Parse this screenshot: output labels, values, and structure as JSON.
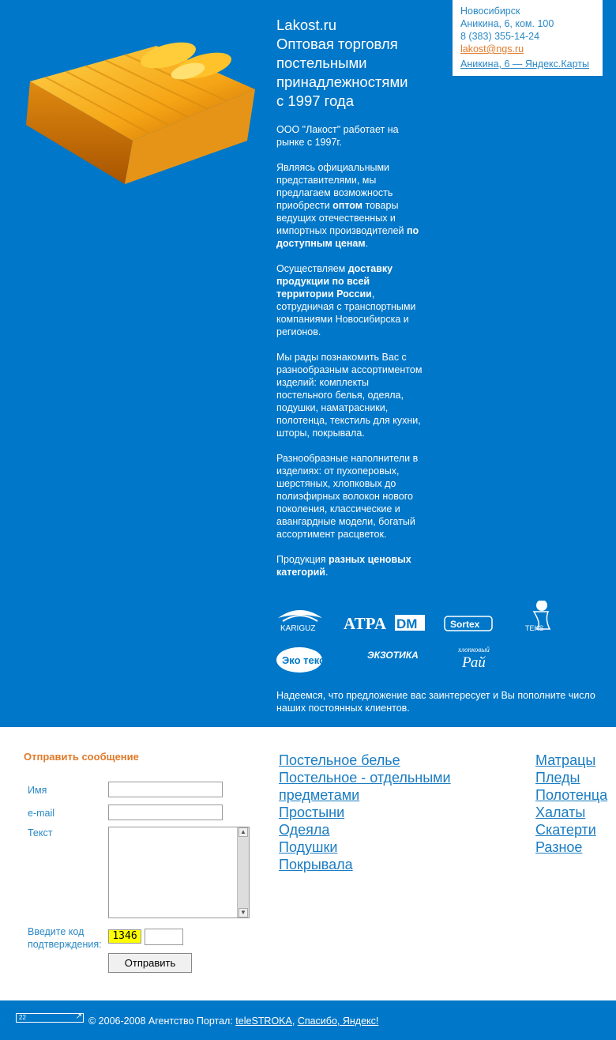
{
  "header": {
    "title_lines": [
      "Lakost.ru",
      "Оптовая торговля",
      "постельными",
      "принадлежностями",
      "с 1997 года"
    ]
  },
  "contact": {
    "city": "Новосибирск",
    "address": "Аникина, 6, ком. 100",
    "phone": "8 (383) 355-14-24",
    "email": "lakost@ngs.ru",
    "map_link": "Аникина, 6 — Яндекс.Карты"
  },
  "about": {
    "p1": "ООО \"Лакост\" работает на рынке с 1997г.",
    "p2_a": "Являясь официальными представителями, мы предлагаем возможность приобрести ",
    "p2_b": "оптом",
    "p2_c": " товары ведущих отечественных и импортных производителей ",
    "p2_d": "по доступным ценам",
    "p2_e": ".",
    "p3_a": "Осуществляем ",
    "p3_b": "доставку продукции по всей территории России",
    "p3_c": ", сотрудничая с транспортными компаниями Новосибирска и регионов.",
    "p4": "Мы рады познакомить Вас с разнообразным ассортиментом изделий: комплекты постельного белья, одеяла, подушки, наматрасники, полотенца, текстиль для кухни, шторы, покрывала.",
    "p5": "Разнообразные наполнители в изделиях: от пухоперовых, шерстяных, хлопковых до полиэфирных волокон нового поколения, классические и авангардные модели, богатый ассортимент расцветок.",
    "p6_a": "Продукция ",
    "p6_b": "разных ценовых категорий",
    "p6_c": ".",
    "hope": "Надеемся, что предложение вас заинтересует и Вы пополните число наших постоянных клиентов."
  },
  "brands": {
    "kariguz": "KARIGUZ",
    "atpa": "ATPA",
    "dm": "DM",
    "sortex": "Sortex",
    "teks": "TEKS",
    "ekoteks": "Эко текс",
    "ekzotika": "ЭКЗОТИКА",
    "rai_small": "хлопковый",
    "rai": "Рай"
  },
  "form": {
    "title": "Отправить сообщение",
    "name_label": "Имя",
    "email_label": "e-mail",
    "text_label": "Текст",
    "captcha_label_1": "Введите код",
    "captcha_label_2": "подтверждения:",
    "captcha_code": "1346",
    "submit": "Отправить"
  },
  "categories_left": [
    "Постельное белье",
    "Постельное - отдельными предметами",
    "Простыни",
    "Одеяла",
    "Подушки",
    "Покрывала"
  ],
  "categories_right": [
    "Матрацы",
    "Пледы",
    "Полотенца",
    "Халаты",
    "Скатерти",
    "Разное"
  ],
  "footer": {
    "counter": "22",
    "copyright": "© 2006-2008 Агентство Портал: ",
    "link1": "teleSTROKA",
    "sep": ", ",
    "link2": "Спасибо, Яндекс!"
  },
  "colors": {
    "blue": "#0077c8",
    "link": "#1a7cc2",
    "orange": "#e07a2a"
  }
}
